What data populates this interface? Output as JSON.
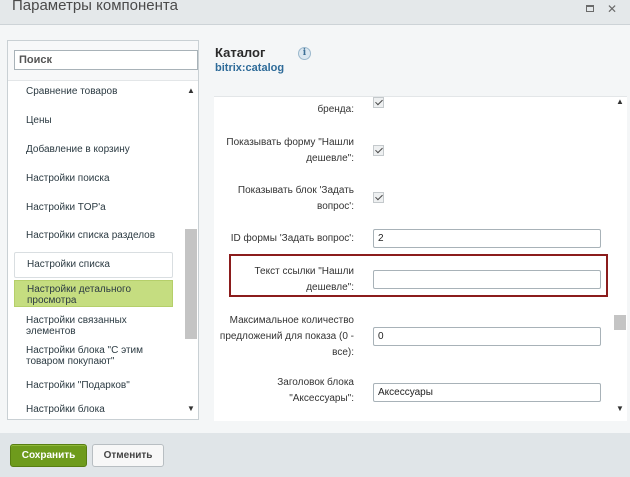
{
  "window": {
    "title": "Параметры компонента",
    "maximize_icon": "maximize-icon",
    "close_icon": "close-icon"
  },
  "search": {
    "placeholder": "Поиск",
    "value": ""
  },
  "sidebar": {
    "items": [
      {
        "label": "Сравнение товаров"
      },
      {
        "label": "Цены"
      },
      {
        "label": "Добавление в корзину"
      },
      {
        "label": "Настройки поиска"
      },
      {
        "label": "Настройки TOP'а"
      },
      {
        "label": "Настройки списка разделов"
      },
      {
        "label": "Настройки списка"
      },
      {
        "label": "Настройки детального просмотра"
      },
      {
        "label": "Настройки связанных элементов"
      },
      {
        "label": "Настройки блока \"С этим товаром покупают\""
      },
      {
        "label": "Настройки \"Подарков\""
      },
      {
        "label": "Настройки блока"
      }
    ],
    "selected_index": 7
  },
  "component": {
    "title": "Каталог",
    "code": "bitrix:catalog",
    "info_icon": "info-icon",
    "info_glyph": "i"
  },
  "params": {
    "brand": {
      "label": "бренда:",
      "checked": true
    },
    "show_cheaper_form": {
      "label": "Показывать форму \"Нашли дешевле\":",
      "checked": true
    },
    "show_ask_block": {
      "label": "Показывать блок 'Задать вопрос':",
      "checked": true
    },
    "ask_form_id": {
      "label": "ID формы 'Задать вопрос':",
      "value": "2"
    },
    "cheaper_link_text": {
      "label": "Текст ссылки \"Нашли дешевле\":",
      "value": ""
    },
    "max_offers": {
      "label": "Максимальное количество предложений для показа (0 - все):",
      "value": "0"
    },
    "accessories_title": {
      "label": "Заголовок блока \"Аксессуары\":",
      "value": "Аксессуары"
    }
  },
  "footer": {
    "save_label": "Сохранить",
    "cancel_label": "Отменить"
  },
  "colors": {
    "save_button": "#6e9b1c",
    "selected_item": "#c5dd80",
    "highlight_border": "#8b1c1c",
    "component_code": "#2e6b99"
  }
}
